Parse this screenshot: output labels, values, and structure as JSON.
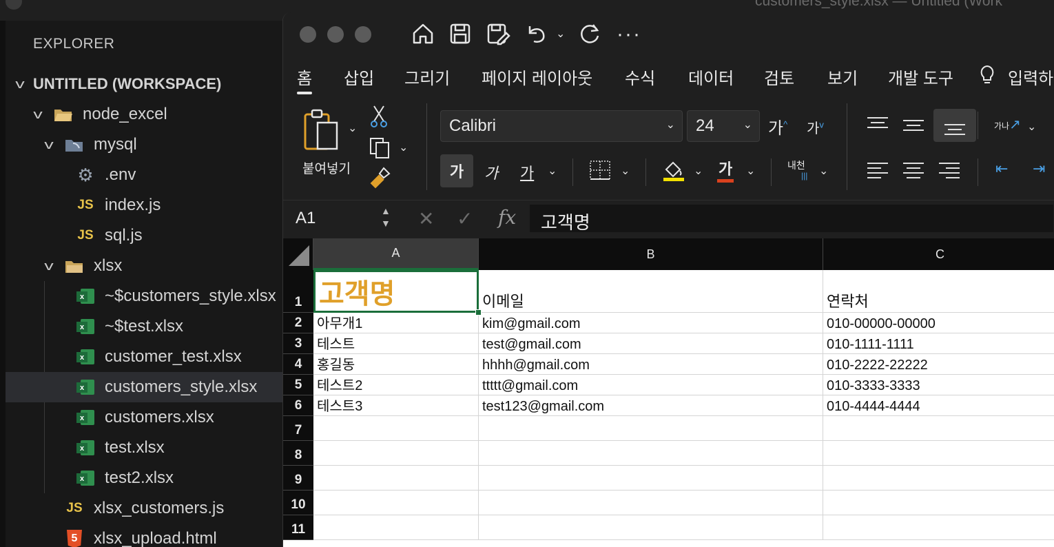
{
  "vscode": {
    "window_title": "customers_style.xlsx — Untitled (Work",
    "explorer_title": "EXPLORER",
    "workspace": "UNTITLED (WORKSPACE)",
    "tree": [
      {
        "label": "node_excel",
        "icon": "open-folder-icon"
      },
      {
        "label": "mysql",
        "icon": "database-folder-icon"
      },
      {
        "label": ".env",
        "icon": "gear-icon"
      },
      {
        "label": "index.js",
        "icon": "js-icon"
      },
      {
        "label": "sql.js",
        "icon": "js-icon"
      },
      {
        "label": "xlsx",
        "icon": "folder-icon"
      },
      {
        "label": "~$customers_style.xlsx",
        "icon": "excel-file-icon"
      },
      {
        "label": "~$test.xlsx",
        "icon": "excel-file-icon"
      },
      {
        "label": "customer_test.xlsx",
        "icon": "excel-file-icon"
      },
      {
        "label": "customers_style.xlsx",
        "icon": "excel-file-icon"
      },
      {
        "label": "customers.xlsx",
        "icon": "excel-file-icon"
      },
      {
        "label": "test.xlsx",
        "icon": "excel-file-icon"
      },
      {
        "label": "test2.xlsx",
        "icon": "excel-file-icon"
      },
      {
        "label": "xlsx_customers.js",
        "icon": "js-icon"
      },
      {
        "label": "xlsx_upload.html",
        "icon": "html5-icon"
      }
    ],
    "js_badge": "JS",
    "html_badge": "5",
    "xl_badge": "x"
  },
  "excel": {
    "tabs": [
      "홈",
      "삽입",
      "그리기",
      "페이지 레이아웃",
      "수식",
      "데이터",
      "검토",
      "보기",
      "개발 도구",
      "입력하"
    ],
    "paste_label": "붙여넣기",
    "font_name": "Calibri",
    "font_size": "24",
    "bold_glyph": "가",
    "italic_glyph": "가",
    "underline_glyph": "가",
    "font_color_glyph": "가",
    "grow_glyph": "가",
    "shrink_glyph": "가",
    "phonetic_label": "내천",
    "orientation_label": "가나",
    "name_box": "A1",
    "fx_label": "fx",
    "formula_value": "고객명",
    "columns": [
      "A",
      "B",
      "C"
    ],
    "rows": [
      "1",
      "2",
      "3",
      "4",
      "5",
      "6",
      "7",
      "8",
      "9",
      "10",
      "11"
    ],
    "cells": [
      [
        "고객명",
        "이메일",
        "연락처"
      ],
      [
        "아무개1",
        "kim@gmail.com",
        "010-00000-00000"
      ],
      [
        "테스트",
        "test@gmail.com",
        "010-1111-1111"
      ],
      [
        "홍길동",
        "hhhh@gmail.com",
        "010-2222-22222"
      ],
      [
        "테스트2",
        "ttttt@gmail.com",
        "010-3333-3333"
      ],
      [
        "테스트3",
        "test123@gmail.com",
        "010-4444-4444"
      ]
    ],
    "accent_color": "#e0a02a",
    "selection_color": "#1a6e3a"
  }
}
